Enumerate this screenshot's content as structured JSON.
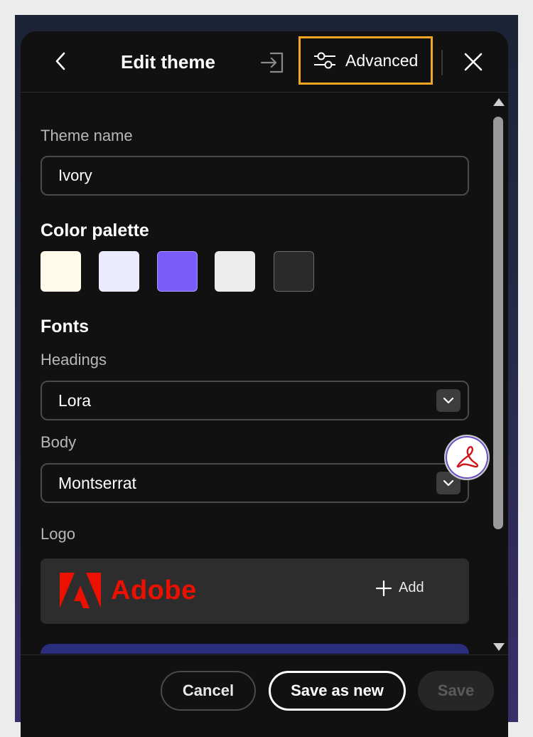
{
  "header": {
    "title": "Edit theme",
    "advanced_label": "Advanced",
    "back_icon": "chevron-left-icon",
    "import_icon": "import-icon",
    "advanced_icon": "sliders-icon",
    "close_icon": "close-icon"
  },
  "theme_name": {
    "label": "Theme name",
    "value": "Ivory"
  },
  "color_palette": {
    "title": "Color palette",
    "swatches": [
      "#fffaea",
      "#ebebfe",
      "#7a5cfa",
      "#ececec",
      "#2a2a2a"
    ]
  },
  "fonts": {
    "title": "Fonts",
    "headings_label": "Headings",
    "headings_value": "Lora",
    "body_label": "Body",
    "body_value": "Montserrat"
  },
  "logo": {
    "label": "Logo",
    "brand_text": "Adobe",
    "add_label": "Add"
  },
  "footer": {
    "cancel_label": "Cancel",
    "save_new_label": "Save as new",
    "save_label": "Save"
  },
  "colors": {
    "highlight": "#f5a623",
    "adobe_red": "#eb1000",
    "panel_bg": "#111111"
  }
}
